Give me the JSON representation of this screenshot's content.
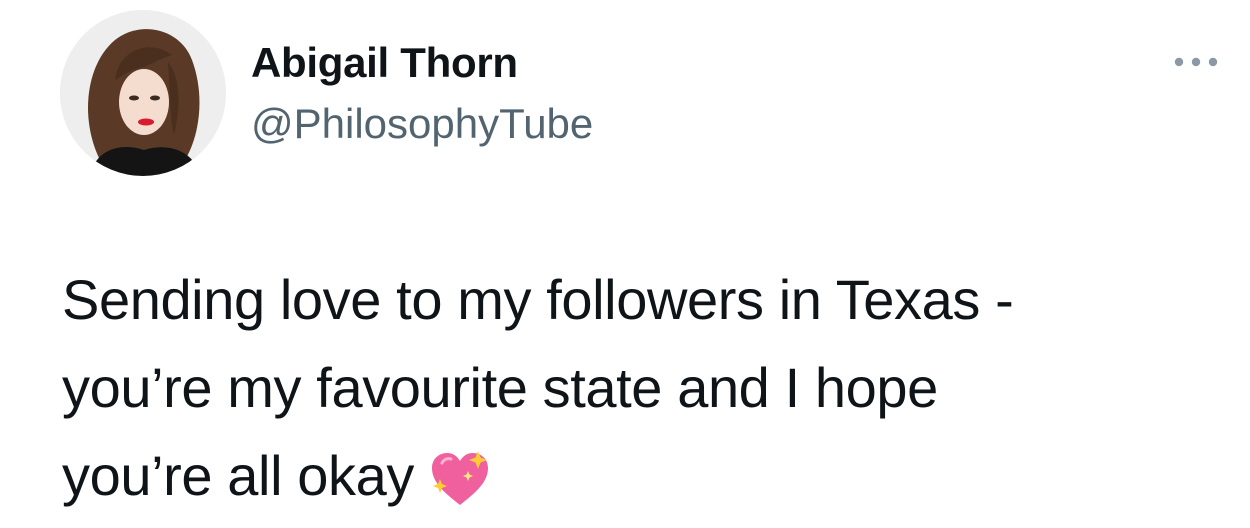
{
  "tweet": {
    "author": {
      "display_name": "Abigail Thorn",
      "handle": "@PhilosophyTube"
    },
    "text": "Sending love to my followers in Texas -\nyou’re my favourite state and I hope\nyou’re all okay",
    "emoji": "sparkling-heart",
    "more_icon": "more-horizontal-icon"
  },
  "colors": {
    "text_primary": "#0f1419",
    "text_secondary": "#536471",
    "heart_pink": "#f0609e"
  }
}
